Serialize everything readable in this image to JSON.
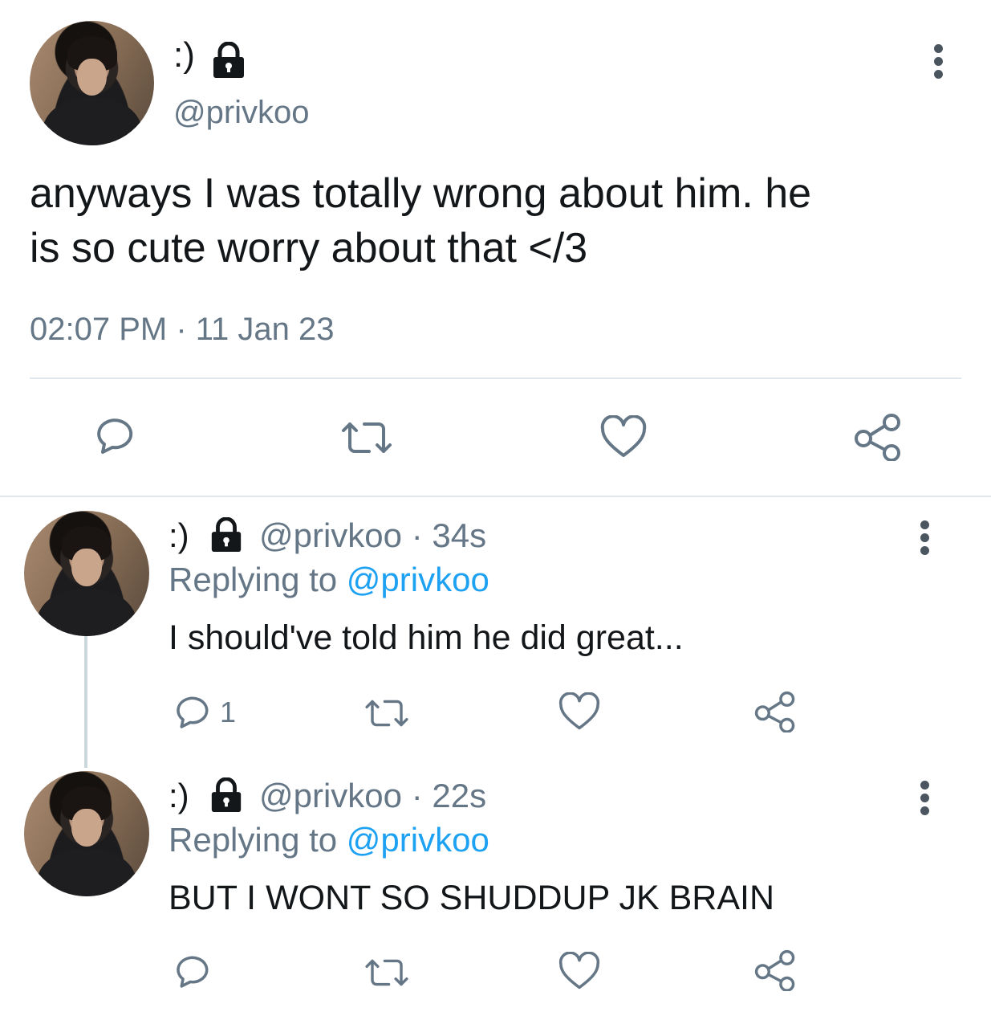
{
  "main_tweet": {
    "display_name": ":)",
    "handle": "@privkoo",
    "text_line1": "anyways I was totally wrong about him. he",
    "text_line2": "is so cute worry about that </3",
    "timestamp": "02:07 PM · 11 Jan 23"
  },
  "replies": [
    {
      "display_name": ":)",
      "handle": "@privkoo",
      "time": "· 34s",
      "replying_prefix": "Replying to",
      "replying_handle": "@privkoo",
      "text": "I should've told him he did great...",
      "reply_count": "1"
    },
    {
      "display_name": ":)",
      "handle": "@privkoo",
      "time": "· 22s",
      "replying_prefix": "Replying to",
      "replying_handle": "@privkoo",
      "text": "BUT I WONT SO SHUDDUP JK BRAIN",
      "reply_count": ""
    }
  ],
  "icons": [
    "lock-icon",
    "more-icon",
    "reply-icon",
    "retweet-icon",
    "like-icon",
    "share-icon"
  ],
  "colors": {
    "link": "#1da1f2",
    "secondary_text": "#657786",
    "icon": "#657786",
    "divider": "#e1e8ed"
  }
}
